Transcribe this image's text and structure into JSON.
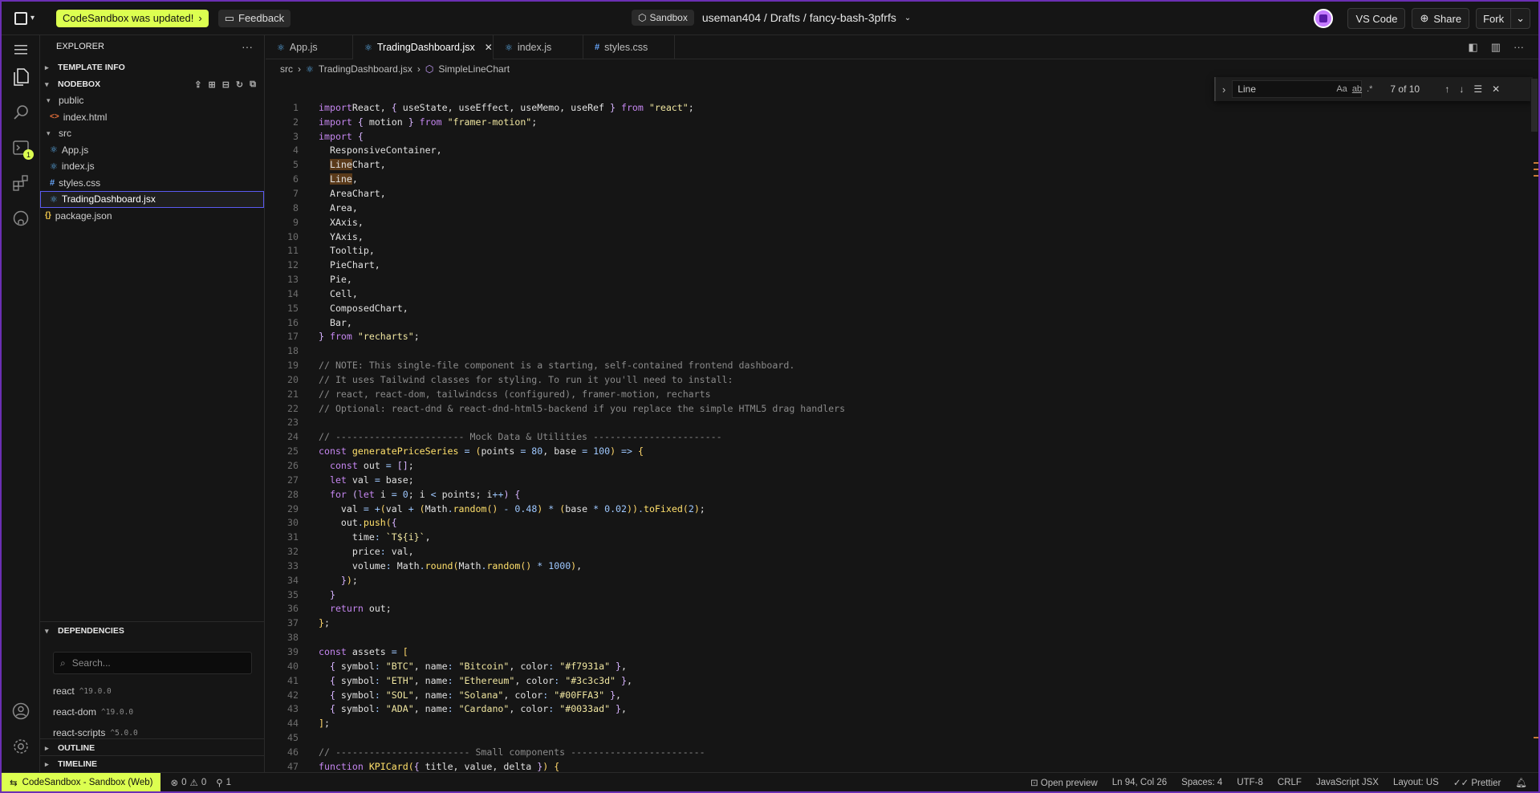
{
  "colors": {
    "accent": "#dcff50",
    "window_border": "#6b2fb3",
    "selection_outline": "#5a5af0",
    "find_highlight": "#5a3a1a"
  },
  "topbar": {
    "updated_label": "CodeSandbox was updated!",
    "feedback_label": "Feedback",
    "sandbox_badge": "Sandbox",
    "breadcrumb": "useman404 / Drafts / fancy-bash-3pfrfs",
    "vscode_label": "VS Code",
    "share_label": "Share",
    "fork_label": "Fork"
  },
  "sidebar": {
    "title": "EXPLORER",
    "template_info": "TEMPLATE INFO",
    "nodebox": "NODEBOX",
    "tree": [
      {
        "label": "public",
        "type": "folder"
      },
      {
        "label": "index.html",
        "type": "html"
      },
      {
        "label": "src",
        "type": "folder"
      },
      {
        "label": "App.js",
        "type": "react"
      },
      {
        "label": "index.js",
        "type": "react"
      },
      {
        "label": "styles.css",
        "type": "css"
      },
      {
        "label": "TradingDashboard.jsx",
        "type": "react"
      },
      {
        "label": "package.json",
        "type": "json"
      }
    ],
    "dependencies_title": "DEPENDENCIES",
    "search_placeholder": "Search...",
    "dependencies": [
      {
        "name": "react",
        "version": "^19.0.0"
      },
      {
        "name": "react-dom",
        "version": "^19.0.0"
      },
      {
        "name": "react-scripts",
        "version": "^5.0.0"
      }
    ],
    "outline": "OUTLINE",
    "timeline": "TIMELINE"
  },
  "tabs": [
    {
      "label": "App.js"
    },
    {
      "label": "TradingDashboard.jsx"
    },
    {
      "label": "index.js"
    },
    {
      "label": "styles.css"
    }
  ],
  "breadcrumbs": [
    "src",
    "TradingDashboard.jsx",
    "SimpleLineChart"
  ],
  "find": {
    "query": "Line",
    "count": "7 of 10"
  },
  "code_lines": [
    [
      [
        "kw",
        "import"
      ],
      [
        "",
        "React, "
      ],
      [
        "pn1",
        "{"
      ],
      [
        "",
        " useState, useEffect, useMemo, useRef "
      ],
      [
        "pn1",
        "}"
      ],
      [
        "",
        " "
      ],
      [
        "kw",
        "from"
      ],
      [
        "",
        " "
      ],
      [
        "str",
        "\"react\""
      ],
      [
        "",
        ";"
      ]
    ],
    [
      [
        "kw",
        "import"
      ],
      [
        "",
        " "
      ],
      [
        "pn1",
        "{"
      ],
      [
        "",
        " motion "
      ],
      [
        "pn1",
        "}"
      ],
      [
        "",
        " "
      ],
      [
        "kw",
        "from"
      ],
      [
        "",
        " "
      ],
      [
        "str",
        "\"framer-motion\""
      ],
      [
        "",
        ";"
      ]
    ],
    [
      [
        "kw",
        "import"
      ],
      [
        "",
        " "
      ],
      [
        "pn1",
        "{"
      ]
    ],
    [
      [
        "",
        "  ResponsiveContainer,"
      ]
    ],
    [
      [
        "",
        "  "
      ],
      [
        "hl",
        "Line"
      ],
      [
        "",
        "Chart,"
      ]
    ],
    [
      [
        "",
        "  "
      ],
      [
        "hl",
        "Line"
      ],
      [
        "",
        ","
      ]
    ],
    [
      [
        "",
        "  AreaChart,"
      ]
    ],
    [
      [
        "",
        "  Area,"
      ]
    ],
    [
      [
        "",
        "  XAxis,"
      ]
    ],
    [
      [
        "",
        "  YAxis,"
      ]
    ],
    [
      [
        "",
        "  Tooltip,"
      ]
    ],
    [
      [
        "",
        "  PieChart,"
      ]
    ],
    [
      [
        "",
        "  Pie,"
      ]
    ],
    [
      [
        "",
        "  Cell,"
      ]
    ],
    [
      [
        "",
        "  ComposedChart,"
      ]
    ],
    [
      [
        "",
        "  Bar,"
      ]
    ],
    [
      [
        "pn1",
        "}"
      ],
      [
        "",
        " "
      ],
      [
        "kw",
        "from"
      ],
      [
        "",
        " "
      ],
      [
        "str",
        "\"recharts\""
      ],
      [
        "",
        ";"
      ]
    ],
    [
      [
        "",
        ""
      ]
    ],
    [
      [
        "cmt",
        "// NOTE: This single-file component is a starting, self-contained frontend dashboard."
      ]
    ],
    [
      [
        "cmt",
        "// It uses Tailwind classes for styling. To run it you'll need to install:"
      ]
    ],
    [
      [
        "cmt",
        "// react, react-dom, tailwindcss (configured), framer-motion, recharts"
      ]
    ],
    [
      [
        "cmt",
        "// Optional: react-dnd & react-dnd-html5-backend if you replace the simple HTML5 drag handlers"
      ]
    ],
    [
      [
        "",
        ""
      ]
    ],
    [
      [
        "cmt",
        "// ----------------------- Mock Data & Utilities -----------------------"
      ]
    ],
    [
      [
        "kw",
        "const"
      ],
      [
        "",
        " "
      ],
      [
        "fn",
        "generatePriceSeries"
      ],
      [
        "",
        " "
      ],
      [
        "op",
        "="
      ],
      [
        "",
        " "
      ],
      [
        "pn2",
        "("
      ],
      [
        "",
        "points "
      ],
      [
        "op",
        "="
      ],
      [
        "",
        " "
      ],
      [
        "num",
        "80"
      ],
      [
        "",
        ", base "
      ],
      [
        "op",
        "="
      ],
      [
        "",
        " "
      ],
      [
        "num",
        "100"
      ],
      [
        "pn2",
        ")"
      ],
      [
        "",
        " "
      ],
      [
        "op",
        "=>"
      ],
      [
        "",
        " "
      ],
      [
        "pn2",
        "{"
      ]
    ],
    [
      [
        "",
        "  "
      ],
      [
        "kw",
        "const"
      ],
      [
        "",
        " out "
      ],
      [
        "op",
        "="
      ],
      [
        "",
        " "
      ],
      [
        "pn1",
        "[]"
      ],
      [
        "",
        ";"
      ]
    ],
    [
      [
        "",
        "  "
      ],
      [
        "kw",
        "let"
      ],
      [
        "",
        " val "
      ],
      [
        "op",
        "="
      ],
      [
        "",
        " base;"
      ]
    ],
    [
      [
        "",
        "  "
      ],
      [
        "kw",
        "for"
      ],
      [
        "",
        " "
      ],
      [
        "pn1",
        "("
      ],
      [
        "kw",
        "let"
      ],
      [
        "",
        " i "
      ],
      [
        "op",
        "="
      ],
      [
        "",
        " "
      ],
      [
        "num",
        "0"
      ],
      [
        "",
        "; i "
      ],
      [
        "op",
        "<"
      ],
      [
        "",
        " points; i"
      ],
      [
        "op",
        "++"
      ],
      [
        "pn1",
        ")"
      ],
      [
        "",
        " "
      ],
      [
        "pn1",
        "{"
      ]
    ],
    [
      [
        "",
        "    val "
      ],
      [
        "op",
        "="
      ],
      [
        "",
        " "
      ],
      [
        "op",
        "+"
      ],
      [
        "pn2",
        "("
      ],
      [
        "",
        "val "
      ],
      [
        "op",
        "+"
      ],
      [
        "",
        " "
      ],
      [
        "pn2",
        "("
      ],
      [
        "",
        "Math"
      ],
      [
        "op",
        "."
      ],
      [
        "fn",
        "random"
      ],
      [
        "pn2",
        "()"
      ],
      [
        "",
        " "
      ],
      [
        "op",
        "-"
      ],
      [
        "",
        " "
      ],
      [
        "num",
        "0.48"
      ],
      [
        "pn2",
        ")"
      ],
      [
        "",
        " "
      ],
      [
        "op",
        "*"
      ],
      [
        "",
        " "
      ],
      [
        "pn2",
        "("
      ],
      [
        "",
        "base "
      ],
      [
        "op",
        "*"
      ],
      [
        "",
        " "
      ],
      [
        "num",
        "0.02"
      ],
      [
        "pn2",
        "))"
      ],
      [
        "op",
        "."
      ],
      [
        "fn",
        "toFixed"
      ],
      [
        "pn2",
        "("
      ],
      [
        "num",
        "2"
      ],
      [
        "pn2",
        ")"
      ],
      [
        "",
        ";"
      ]
    ],
    [
      [
        "",
        "    out"
      ],
      [
        "op",
        "."
      ],
      [
        "fn",
        "push"
      ],
      [
        "pn2",
        "("
      ],
      [
        "pn1",
        "{"
      ]
    ],
    [
      [
        "",
        "      time"
      ],
      [
        "op",
        ":"
      ],
      [
        "",
        " "
      ],
      [
        "str",
        "`T${i}`"
      ],
      [
        "",
        ","
      ]
    ],
    [
      [
        "",
        "      price"
      ],
      [
        "op",
        ":"
      ],
      [
        "",
        " val,"
      ]
    ],
    [
      [
        "",
        "      volume"
      ],
      [
        "op",
        ":"
      ],
      [
        "",
        " Math"
      ],
      [
        "op",
        "."
      ],
      [
        "fn",
        "round"
      ],
      [
        "pn2",
        "("
      ],
      [
        "",
        "Math"
      ],
      [
        "op",
        "."
      ],
      [
        "fn",
        "random"
      ],
      [
        "pn2",
        "()"
      ],
      [
        "",
        " "
      ],
      [
        "op",
        "*"
      ],
      [
        "",
        " "
      ],
      [
        "num",
        "1000"
      ],
      [
        "pn2",
        ")"
      ],
      [
        "",
        ","
      ]
    ],
    [
      [
        "",
        "    "
      ],
      [
        "pn1",
        "}"
      ],
      [
        "pn2",
        ")"
      ],
      [
        "",
        ";"
      ]
    ],
    [
      [
        "",
        "  "
      ],
      [
        "pn1",
        "}"
      ]
    ],
    [
      [
        "",
        "  "
      ],
      [
        "kw",
        "return"
      ],
      [
        "",
        " out;"
      ]
    ],
    [
      [
        "pn2",
        "}"
      ],
      [
        "",
        ";"
      ]
    ],
    [
      [
        "",
        ""
      ]
    ],
    [
      [
        "kw",
        "const"
      ],
      [
        "",
        " assets "
      ],
      [
        "op",
        "="
      ],
      [
        "",
        " "
      ],
      [
        "pn2",
        "["
      ]
    ],
    [
      [
        "",
        "  "
      ],
      [
        "pn1",
        "{"
      ],
      [
        "",
        " symbol"
      ],
      [
        "op",
        ":"
      ],
      [
        "",
        " "
      ],
      [
        "str",
        "\"BTC\""
      ],
      [
        "",
        ", name"
      ],
      [
        "op",
        ":"
      ],
      [
        "",
        " "
      ],
      [
        "str",
        "\"Bitcoin\""
      ],
      [
        "",
        ", color"
      ],
      [
        "op",
        ":"
      ],
      [
        "",
        " "
      ],
      [
        "str",
        "\"#f7931a\""
      ],
      [
        "",
        " "
      ],
      [
        "pn1",
        "}"
      ],
      [
        "",
        ","
      ]
    ],
    [
      [
        "",
        "  "
      ],
      [
        "pn1",
        "{"
      ],
      [
        "",
        " symbol"
      ],
      [
        "op",
        ":"
      ],
      [
        "",
        " "
      ],
      [
        "str",
        "\"ETH\""
      ],
      [
        "",
        ", name"
      ],
      [
        "op",
        ":"
      ],
      [
        "",
        " "
      ],
      [
        "str",
        "\"Ethereum\""
      ],
      [
        "",
        ", color"
      ],
      [
        "op",
        ":"
      ],
      [
        "",
        " "
      ],
      [
        "str",
        "\"#3c3c3d\""
      ],
      [
        "",
        " "
      ],
      [
        "pn1",
        "}"
      ],
      [
        "",
        ","
      ]
    ],
    [
      [
        "",
        "  "
      ],
      [
        "pn1",
        "{"
      ],
      [
        "",
        " symbol"
      ],
      [
        "op",
        ":"
      ],
      [
        "",
        " "
      ],
      [
        "str",
        "\"SOL\""
      ],
      [
        "",
        ", name"
      ],
      [
        "op",
        ":"
      ],
      [
        "",
        " "
      ],
      [
        "str",
        "\"Solana\""
      ],
      [
        "",
        ", color"
      ],
      [
        "op",
        ":"
      ],
      [
        "",
        " "
      ],
      [
        "str",
        "\"#00FFA3\""
      ],
      [
        "",
        " "
      ],
      [
        "pn1",
        "}"
      ],
      [
        "",
        ","
      ]
    ],
    [
      [
        "",
        "  "
      ],
      [
        "pn1",
        "{"
      ],
      [
        "",
        " symbol"
      ],
      [
        "op",
        ":"
      ],
      [
        "",
        " "
      ],
      [
        "str",
        "\"ADA\""
      ],
      [
        "",
        ", name"
      ],
      [
        "op",
        ":"
      ],
      [
        "",
        " "
      ],
      [
        "str",
        "\"Cardano\""
      ],
      [
        "",
        ", color"
      ],
      [
        "op",
        ":"
      ],
      [
        "",
        " "
      ],
      [
        "str",
        "\"#0033ad\""
      ],
      [
        "",
        " "
      ],
      [
        "pn1",
        "}"
      ],
      [
        "",
        ","
      ]
    ],
    [
      [
        "pn2",
        "]"
      ],
      [
        "",
        ";"
      ]
    ],
    [
      [
        "",
        ""
      ]
    ],
    [
      [
        "cmt",
        "// ------------------------ Small components ------------------------"
      ]
    ],
    [
      [
        "kw",
        "function"
      ],
      [
        "",
        " "
      ],
      [
        "fn",
        "KPICard"
      ],
      [
        "pn2",
        "("
      ],
      [
        "pn1",
        "{"
      ],
      [
        "",
        " title, value, delta "
      ],
      [
        "pn1",
        "}"
      ],
      [
        "pn2",
        ")"
      ],
      [
        "",
        " "
      ],
      [
        "pn2",
        "{"
      ]
    ]
  ],
  "status": {
    "remote": "CodeSandbox - Sandbox (Web)",
    "errors": "0",
    "warnings": "0",
    "ports": "1",
    "open_preview": "Open preview",
    "position": "Ln 94, Col 26",
    "spaces": "Spaces: 4",
    "encoding": "UTF-8",
    "eol": "CRLF",
    "language": "JavaScript JSX",
    "layout": "Layout: US",
    "formatter": "Prettier"
  }
}
